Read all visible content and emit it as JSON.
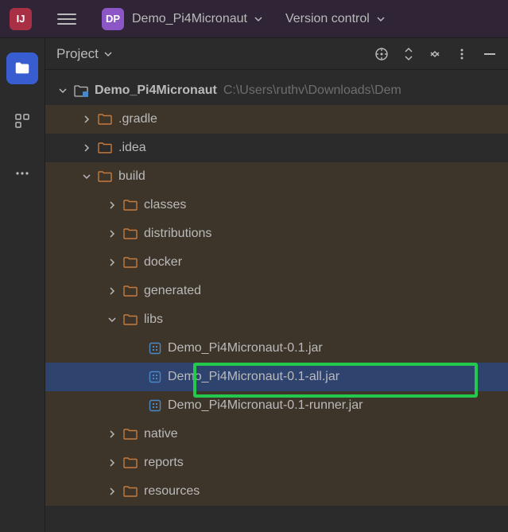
{
  "topbar": {
    "app_icon_text": "IJ",
    "project_badge": "DP",
    "project_name": "Demo_Pi4Micronaut",
    "version_control": "Version control"
  },
  "panel": {
    "title": "Project"
  },
  "tree": {
    "root_name": "Demo_Pi4Micronaut",
    "root_path": "C:\\Users\\ruthv\\Downloads\\Dem",
    "gradle": ".gradle",
    "idea": ".idea",
    "build": "build",
    "classes": "classes",
    "distributions": "distributions",
    "docker": "docker",
    "generated": "generated",
    "libs": "libs",
    "jar1": "Demo_Pi4Micronaut-0.1.jar",
    "jar2": "Demo_Pi4Micronaut-0.1-all.jar",
    "jar3": "Demo_Pi4Micronaut-0.1-runner.jar",
    "native": "native",
    "reports": "reports",
    "resources": "resources"
  }
}
